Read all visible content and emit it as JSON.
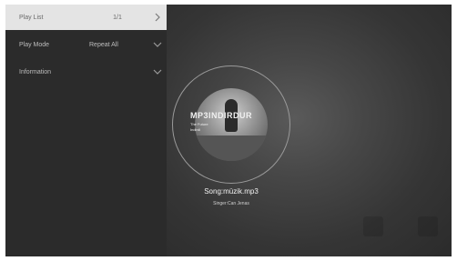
{
  "menu": [
    {
      "label": "Play List",
      "value": "1/1",
      "icon": "chevron-right-icon",
      "active": true
    },
    {
      "label": "Play Mode",
      "value": "Repeat All",
      "icon": "chevron-down-icon",
      "active": false
    },
    {
      "label": "Information",
      "value": "",
      "icon": "chevron-down-icon",
      "active": false
    }
  ],
  "album": {
    "brand_text": "MP3INDIRDUR",
    "line1": "The Future",
    "line2": "Indirdi"
  },
  "now_playing": {
    "song": "Song:müzik.mp3",
    "singer": "Singer:Can Jenas"
  },
  "colors": {
    "active_row": "#e4e4e4",
    "sidebar": "#2b2b2b",
    "text": "#f2f2f2"
  }
}
